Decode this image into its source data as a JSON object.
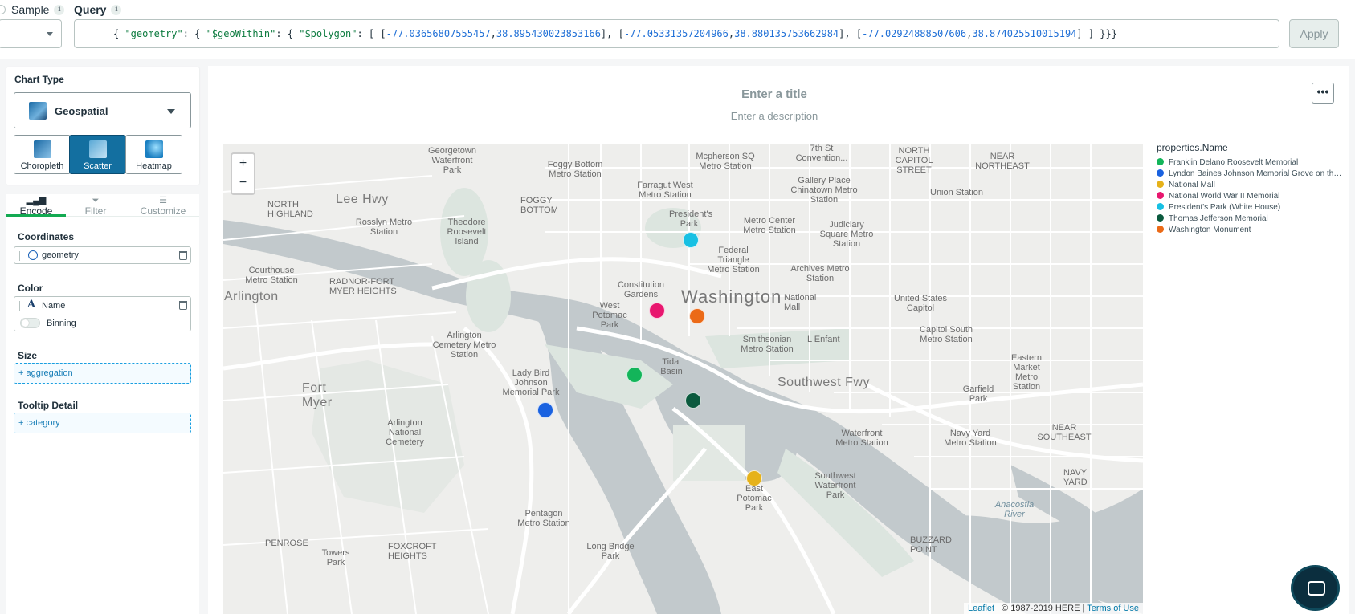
{
  "topbar": {
    "sample_label": "Sample",
    "query_label": "Query",
    "query_text_parts": [
      {
        "t": "{ ",
        "c": "p"
      },
      {
        "t": "\"geometry\"",
        "c": "k"
      },
      {
        "t": ": { ",
        "c": "p"
      },
      {
        "t": "\"$geoWithin\"",
        "c": "k"
      },
      {
        "t": ": { ",
        "c": "p"
      },
      {
        "t": "\"$polygon\"",
        "c": "k"
      },
      {
        "t": ": [ [",
        "c": "p"
      },
      {
        "t": "-77.03656807555457",
        "c": "n"
      },
      {
        "t": ",",
        "c": "p"
      },
      {
        "t": "38.895430023853166",
        "c": "n"
      },
      {
        "t": "], [",
        "c": "p"
      },
      {
        "t": "-77.05331357204966",
        "c": "n"
      },
      {
        "t": ",",
        "c": "p"
      },
      {
        "t": "38.880135753662984",
        "c": "n"
      },
      {
        "t": "], [",
        "c": "p"
      },
      {
        "t": "-77.02924888507606",
        "c": "n"
      },
      {
        "t": ",",
        "c": "p"
      },
      {
        "t": "38.874025510015194",
        "c": "n"
      },
      {
        "t": "] ] }}}",
        "c": "p"
      }
    ],
    "apply_label": "Apply"
  },
  "chart_type": {
    "title": "Chart Type",
    "selected": "Geospatial",
    "subtypes": [
      {
        "label": "Choropleth",
        "active": false
      },
      {
        "label": "Scatter",
        "active": true
      },
      {
        "label": "Heatmap",
        "active": false
      }
    ]
  },
  "tabs": [
    {
      "label": "Encode",
      "active": true
    },
    {
      "label": "Filter",
      "active": false
    },
    {
      "label": "Customize",
      "active": false
    }
  ],
  "encode": {
    "coordinates_title": "Coordinates",
    "coordinates_field": "geometry",
    "color_title": "Color",
    "color_field": "Name",
    "binning_label": "Binning",
    "size_title": "Size",
    "size_drop": "+ aggregation",
    "tooltip_title": "Tooltip Detail",
    "tooltip_drop": "+ category"
  },
  "chart": {
    "title_placeholder": "Enter a title",
    "description_placeholder": "Enter a description",
    "more_label": "•••"
  },
  "map": {
    "zoom_in": "+",
    "zoom_out": "−",
    "attribution_link1": "Leaflet",
    "attribution_text": " | © 1987-2019 HERE | ",
    "attribution_link2": "Terms of Use",
    "labels": {
      "washington": "Washington",
      "arlington": "Arlington",
      "southwest_fwy": "Southwest Fwy",
      "lee_hwy": "Lee Hwy",
      "fort_myer": "Fort Myer",
      "georgetown": "Georgetown Waterfront Park",
      "foggy_bottom": "FOGGY BOTTOM",
      "north_highland": "NORTH HIGHLAND",
      "radnor": "RADNOR-FORT MYER HEIGHTS",
      "roosevelt": "Theodore Roosevelt Island",
      "tidal": "Tidal Basin",
      "east_potomac": "East Potomac Park",
      "national_mall": "National Mall",
      "us_capitol": "United States Capitol",
      "anacostia": "Anacostia River",
      "pentagon": "Pentagon Metro Station",
      "navy_yard": "NAVY YARD",
      "penrose": "PENROSE",
      "foxcroft": "FOXCROFT HEIGHTS",
      "buzzard": "BUZZARD POINT",
      "west_potomac": "West Potomac Park",
      "lady_bird": "Lady Bird Johnson Memorial Park",
      "arlington_cem": "Arlington National Cemetery",
      "presidents_park": "President's Park",
      "constitution": "Constitution Gardens",
      "long_bridge": "Long Bridge Park",
      "sw_waterfront": "Southwest Waterfront Park",
      "north_capitol": "NORTH CAPITOL STREET",
      "near_ne": "NEAR NORTHEAST",
      "near_se": "NEAR SOUTHEAST",
      "union_station": "Union Station",
      "smithsonian": "Smithsonian Metro Station",
      "federal_triangle": "Federal Triangle Metro Station",
      "metro_center": "Metro Center Metro Station",
      "farragut": "Farragut West Metro Station",
      "mcpherson": "Mcpherson SQ Metro Station",
      "gallery_place": "Gallery Place Chinatown Metro Station",
      "judiciary": "Judiciary Square Metro Station",
      "archives": "Archives Metro Station",
      "l_enfant": "L Enfant",
      "capitol_south": "Capitol South Metro Station",
      "eastern_market": "Eastern Market Metro Station",
      "waterfront": "Waterfront Metro Station",
      "navy_yard_station": "Navy Yard Metro Station",
      "rosslyn": "Rosslyn Metro Station",
      "courthouse": "Courthouse Metro Station",
      "arlington_cem_station": "Arlington Cemetery Metro Station",
      "foggy_station": "Foggy Bottom Metro Station",
      "garfield": "Garfield Park",
      "towers": "Towers Park",
      "convention": "7th St Convention..."
    }
  },
  "legend": {
    "title": "properties.Name",
    "items": [
      {
        "label": "Franklin Delano Roosevelt Memorial",
        "color": "#13b55a"
      },
      {
        "label": "Lyndon Baines Johnson Memorial Grove on the Potomac",
        "color": "#1a62e0"
      },
      {
        "label": "National Mall",
        "color": "#e6b21a"
      },
      {
        "label": "National World War II Memorial",
        "color": "#e8176f"
      },
      {
        "label": "President's Park (White House)",
        "color": "#17c0e3"
      },
      {
        "label": "Thomas Jefferson Memorial",
        "color": "#0b5a3e"
      },
      {
        "label": "Washington Monument",
        "color": "#eb6a17"
      }
    ]
  }
}
